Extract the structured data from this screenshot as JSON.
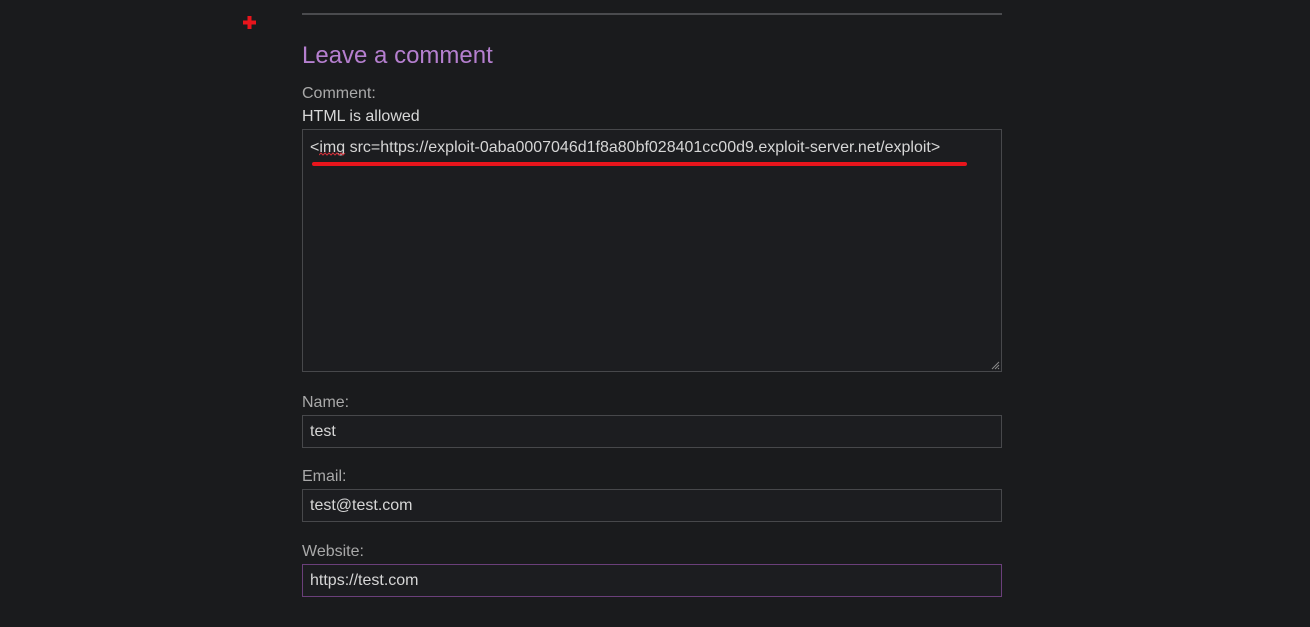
{
  "comment_form": {
    "heading": "Leave a comment",
    "comment_label": "Comment:",
    "comment_hint": "HTML is allowed",
    "comment_value": "<img src=https://exploit-0aba0007046d1f8a80bf028401cc00d9.exploit-server.net/exploit>",
    "name_label": "Name:",
    "name_value": "test",
    "email_label": "Email:",
    "email_value": "test@test.com",
    "website_label": "Website:",
    "website_value": "https://test.com"
  },
  "icons": {
    "annotation_marker": "red-cross-icon",
    "resize_handle": "resize-grip-icon"
  },
  "colors": {
    "background": "#1a1b1d",
    "heading": "#b57fcf",
    "annotation": "#e8151c",
    "focus_border": "#6a3f7a"
  }
}
